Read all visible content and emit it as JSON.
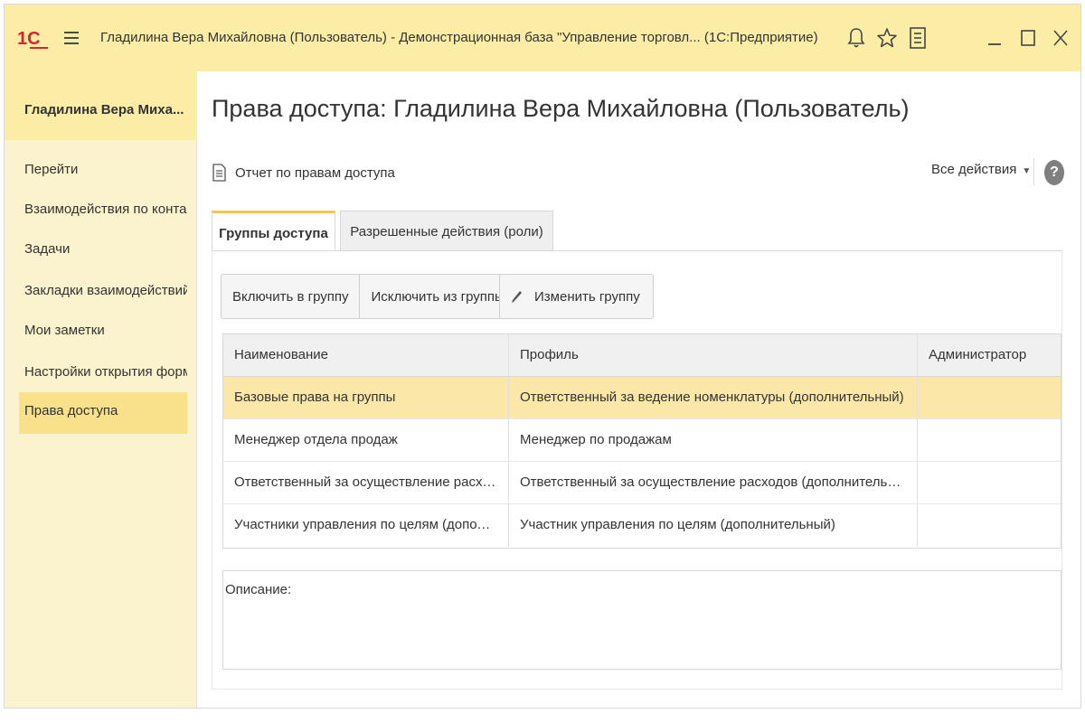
{
  "titlebar": {
    "title": "Гладилина Вера Михайловна (Пользователь) - Демонстрационная база \"Управление торговл...  (1С:Предприятие)",
    "logo_text": "1С"
  },
  "sidebar": {
    "user": "Гладилина Вера Миха...",
    "items": [
      {
        "label": "Перейти"
      },
      {
        "label": "Взаимодействия по конта..."
      },
      {
        "label": "Задачи"
      },
      {
        "label": "Закладки взаимодействий"
      },
      {
        "label": "Мои заметки"
      },
      {
        "label": "Настройки открытия форм..."
      },
      {
        "label": "Права доступа"
      }
    ]
  },
  "main": {
    "title": "Права доступа: Гладилина Вера Михайловна (Пользователь)",
    "report_link": "Отчет по правам доступа",
    "all_actions": "Все действия",
    "help": "?",
    "tabs": [
      {
        "label": "Группы доступа"
      },
      {
        "label": "Разрешенные действия (роли)"
      }
    ],
    "buttons": {
      "include": "Включить в группу",
      "exclude": "Исключить из группы",
      "edit": "Изменить группу"
    },
    "table": {
      "columns": [
        "Наименование",
        "Профиль",
        "Администратор"
      ],
      "rows": [
        {
          "name": "Базовые права на группы",
          "profile": "Ответственный за ведение номенклатуры (дополнительный)",
          "admin": ""
        },
        {
          "name": "Менеджер отдела продаж",
          "profile": "Менеджер по продажам",
          "admin": ""
        },
        {
          "name": "Ответственный за осуществление расходов",
          "profile": "Ответственный за осуществление расходов (дополнительный)",
          "admin": ""
        },
        {
          "name": "Участники управления по целям (дополните...",
          "profile": "Участник управления по целям (дополнительный)",
          "admin": ""
        }
      ]
    },
    "description_label": "Описание:"
  },
  "colors": {
    "titlebar_bg": "#fbeda6",
    "sidebar_bg": "#fbf3ce",
    "active_item": "#f9e08b",
    "selected_row": "#fbe7a8",
    "logo_red": "#d9232e"
  }
}
